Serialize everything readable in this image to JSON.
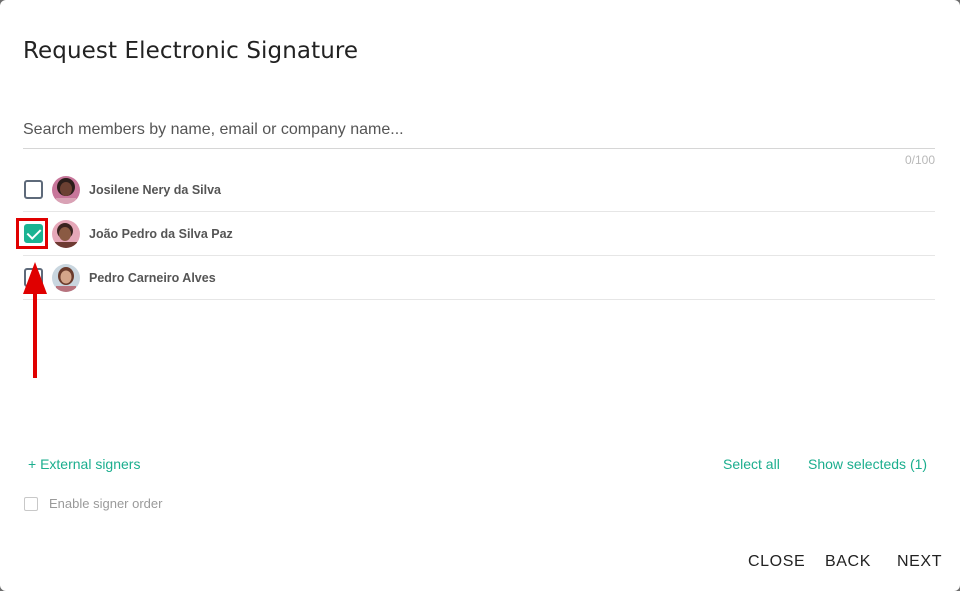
{
  "dialog": {
    "title": "Request Electronic Signature",
    "search_placeholder": "Search members by name, email or company name...",
    "counter": "0/100"
  },
  "members": [
    {
      "name": "Josilene Nery da Silva",
      "checked": false
    },
    {
      "name": "João Pedro da Silva Paz",
      "checked": true
    },
    {
      "name": "Pedro Carneiro Alves",
      "checked": false
    }
  ],
  "actions": {
    "external_signers": "+ External signers",
    "select_all": "Select all",
    "show_selecteds": "Show selecteds (1)",
    "enable_signer_order": "Enable signer order"
  },
  "footer": {
    "close": "CLOSE",
    "back": "BACK",
    "next": "NEXT"
  },
  "colors": {
    "accent": "#1bb392",
    "annotation": "#e00000"
  }
}
